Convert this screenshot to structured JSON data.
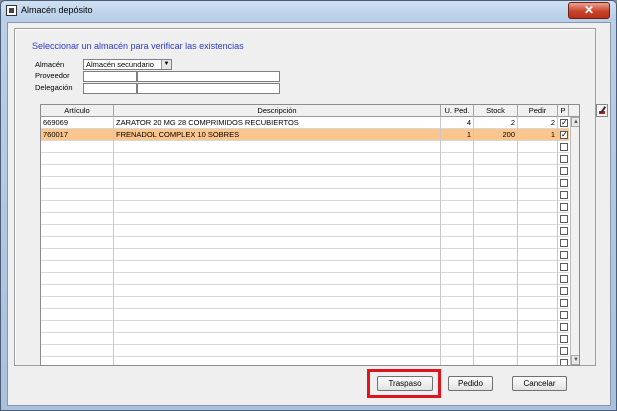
{
  "window": {
    "title": "Almacén depósito",
    "close_glyph": "✕"
  },
  "form": {
    "heading": "Seleccionar un almacén para verificar las existencias",
    "almacen_label": "Almacén",
    "almacen_value": "Almacén secundario",
    "proveedor_label": "Proveedor",
    "proveedor_value": "",
    "delegacion_label": "Delegación",
    "delegacion_value": ""
  },
  "grid": {
    "columns": [
      "Artículo",
      "Descripción",
      "U. Ped.",
      "Stock",
      "Pedir",
      "P"
    ],
    "rows": [
      {
        "articulo": "669069",
        "descripcion": "ZARATOR 20 MG 28 COMPRIMIDOS RECUBIERTOS",
        "u_ped": "4",
        "stock": "2",
        "pedir": "2",
        "checked": true,
        "selected": false
      },
      {
        "articulo": "760017",
        "descripcion": "FRENADOL COMPLEX 10 SOBRES",
        "u_ped": "1",
        "stock": "200",
        "pedir": "1",
        "checked": true,
        "selected": true
      }
    ],
    "empty_rows": 19,
    "selected_row_color": "#fbc58e"
  },
  "buttons": {
    "traspaso": "Traspaso",
    "pedido": "Pedido",
    "cancelar": "Cancelar"
  },
  "annotation": {
    "highlight_color": "#e0141c"
  }
}
